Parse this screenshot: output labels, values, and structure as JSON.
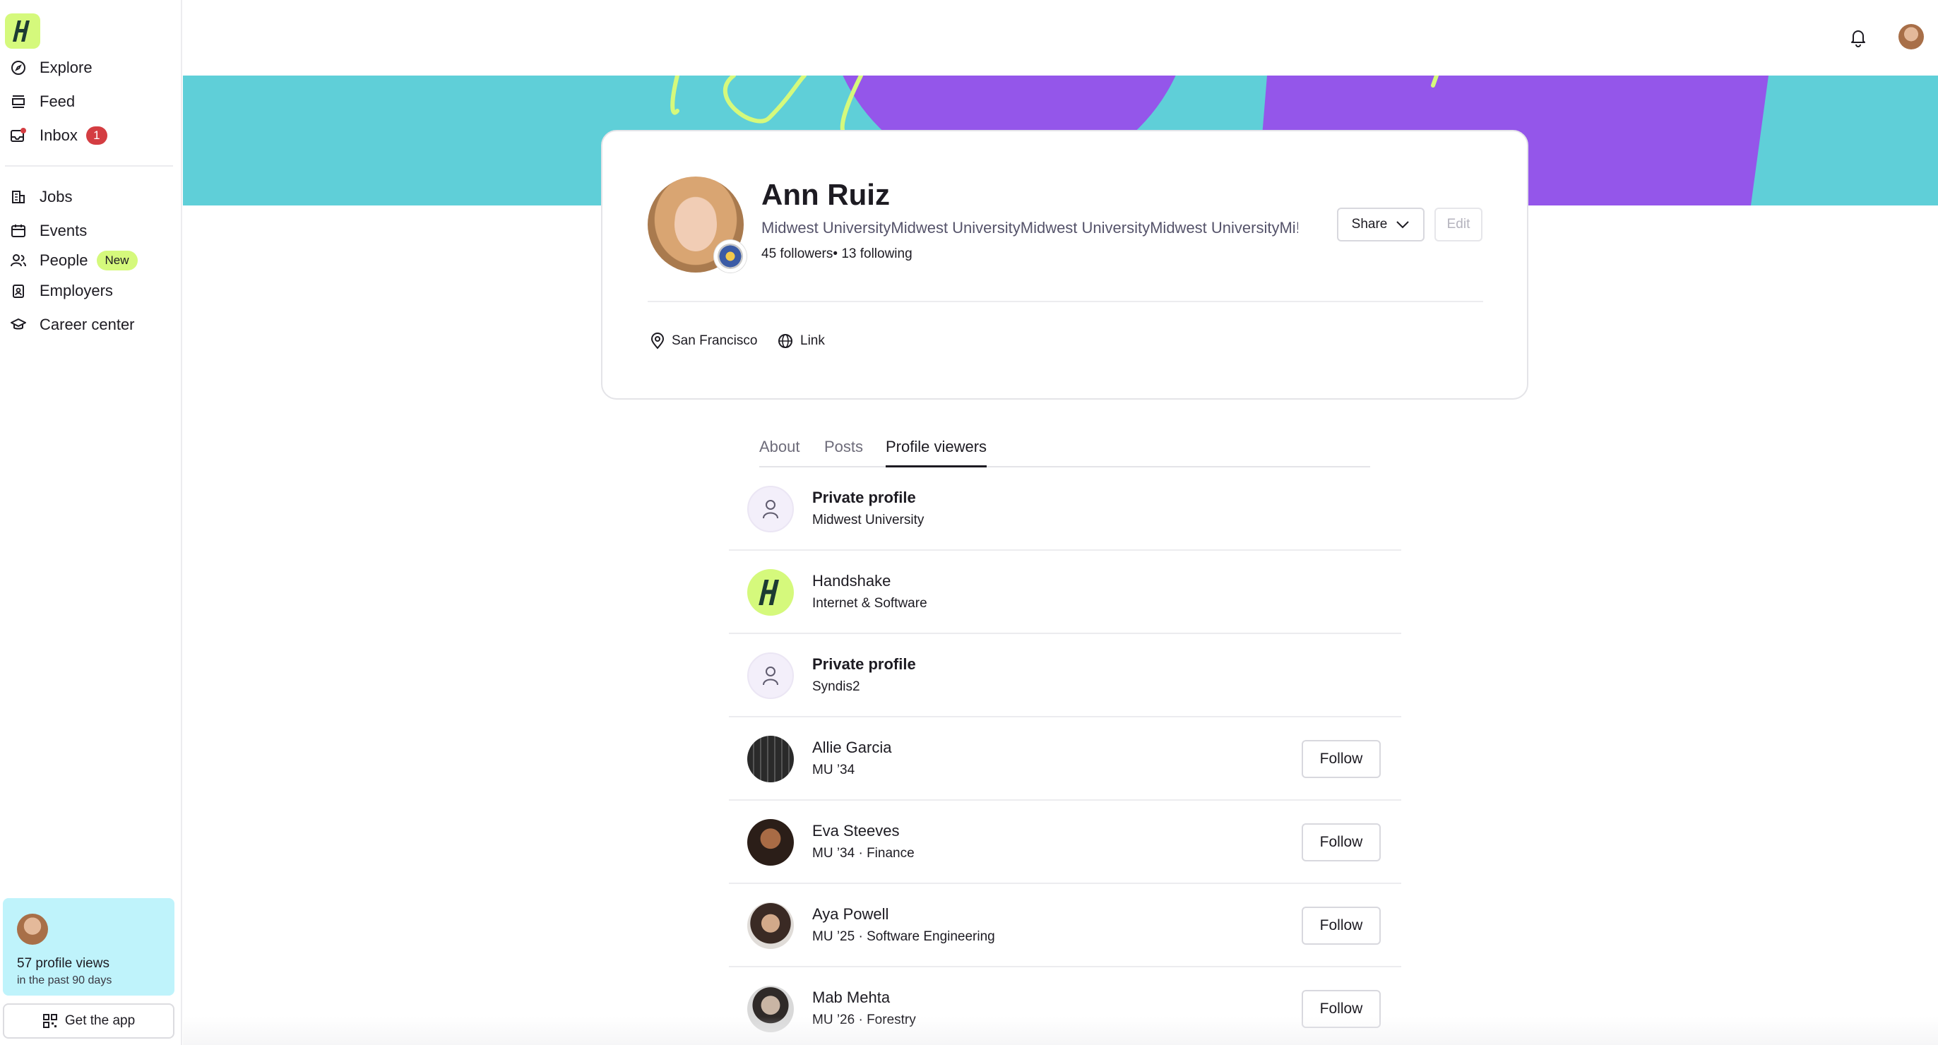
{
  "sidebar": {
    "items": [
      {
        "label": "Explore",
        "icon": "compass-icon"
      },
      {
        "label": "Feed",
        "icon": "feed-icon"
      },
      {
        "label": "Inbox",
        "icon": "inbox-icon",
        "badge": "1"
      },
      {
        "label": "Jobs",
        "icon": "building-icon"
      },
      {
        "label": "Events",
        "icon": "calendar-icon"
      },
      {
        "label": "People",
        "icon": "people-icon",
        "badge": "New"
      },
      {
        "label": "Employers",
        "icon": "employer-badge-icon"
      },
      {
        "label": "Career center",
        "icon": "graduation-cap-icon"
      }
    ],
    "views_card": {
      "count_text": "57 profile views",
      "period_text": "in the past 90 days"
    },
    "get_app_label": "Get the app"
  },
  "colors": {
    "brand_lime": "#d5f97c",
    "banner_teal": "#5fcfd8",
    "banner_purple": "#9456ea",
    "badge_red": "#d43d42",
    "views_card_bg": "#bff3fb"
  },
  "profile": {
    "name": "Ann Ruiz",
    "school_line": "Midwest UniversityMidwest UniversityMidwest UniversityMidwest UniversityMi!",
    "follow_stats": "45 followers• 13 following",
    "share_label": "Share",
    "edit_label": "Edit",
    "location": "San Francisco",
    "link_label": "Link"
  },
  "tabs": [
    {
      "label": "About",
      "active": false
    },
    {
      "label": "Posts",
      "active": false
    },
    {
      "label": "Profile viewers",
      "active": true
    }
  ],
  "viewers": [
    {
      "name": "Private profile",
      "sub": "Midwest University",
      "avatar": "person-icon",
      "follow": false
    },
    {
      "name": "Handshake",
      "sub": "Internet & Software",
      "avatar": "handshake-logo",
      "follow": false
    },
    {
      "name": "Private profile",
      "sub": "Syndis2",
      "avatar": "person-icon",
      "follow": false
    },
    {
      "name": "Allie Garcia",
      "sub": "MU ’34",
      "avatar": "photo",
      "follow": true,
      "follow_label": "Follow"
    },
    {
      "name": "Eva Steeves",
      "sub": "MU ’34 · Finance",
      "avatar": "photo",
      "follow": true,
      "follow_label": "Follow"
    },
    {
      "name": "Aya Powell",
      "sub": "MU ’25 · Software Engineering",
      "avatar": "photo",
      "follow": true,
      "follow_label": "Follow"
    },
    {
      "name": "Mab Mehta",
      "sub": "MU ’26 · Forestry",
      "avatar": "photo",
      "follow": true,
      "follow_label": "Follow"
    }
  ]
}
